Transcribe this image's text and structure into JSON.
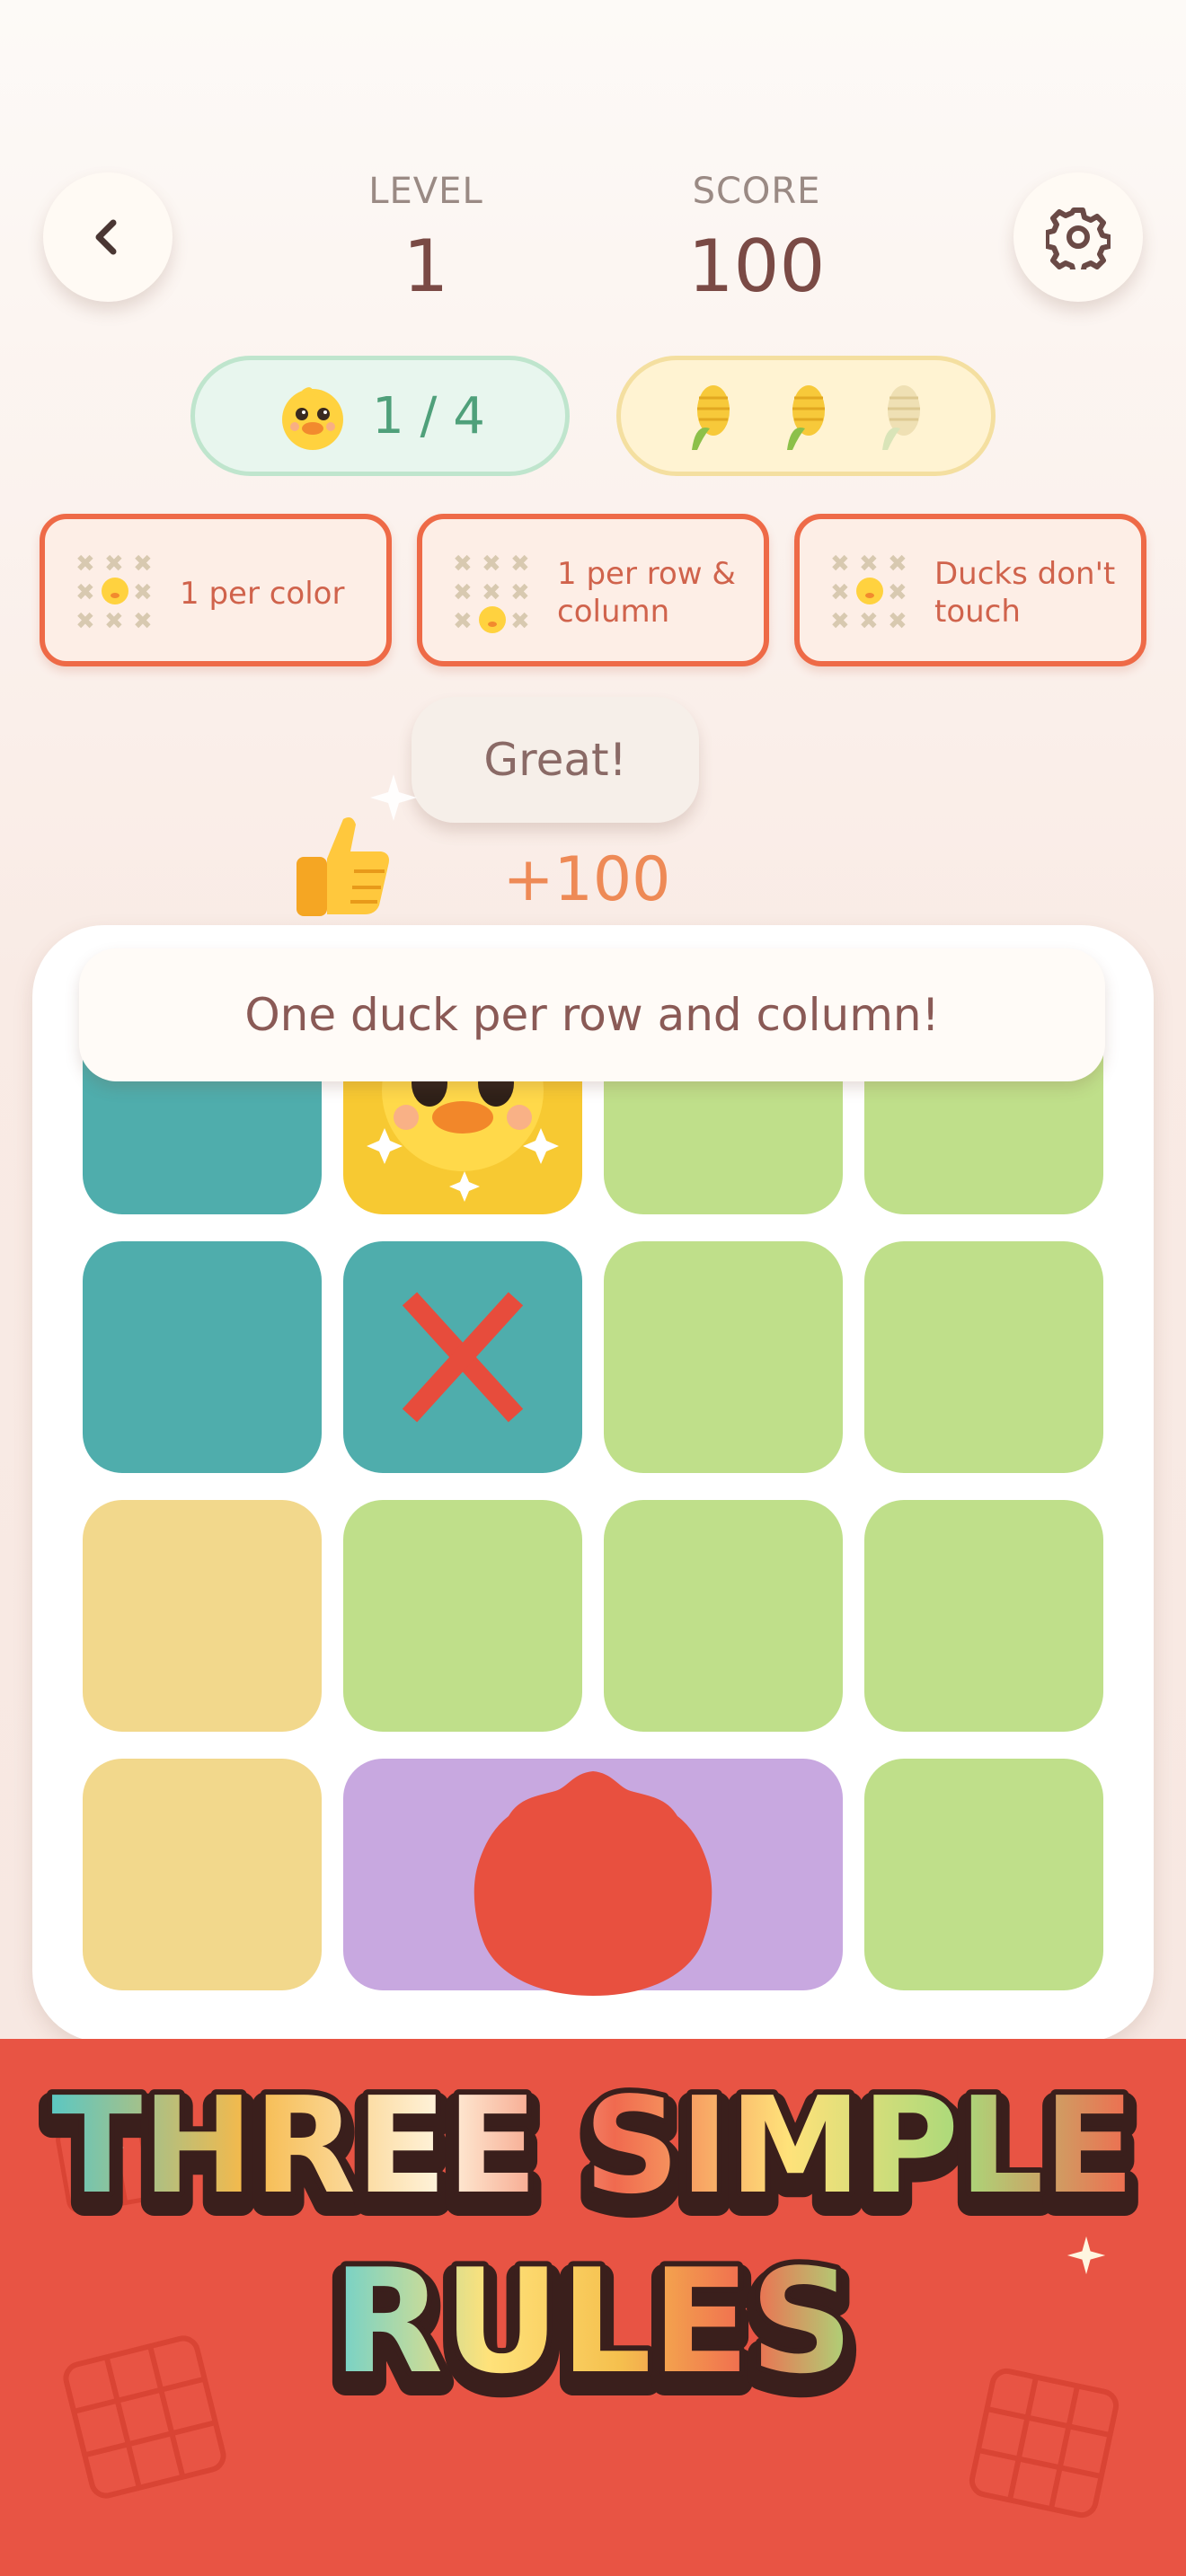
{
  "header": {
    "back_icon": "chevron-left-icon",
    "settings_icon": "gear-icon",
    "level_label": "LEVEL",
    "level_value": "1",
    "score_label": "SCORE",
    "score_value": "100"
  },
  "progress": {
    "ducks_text": "1 / 4",
    "ducks_icon": "duck-icon",
    "corn_icons": [
      "corn-icon",
      "corn-icon",
      "corn-faded-icon"
    ],
    "corn_collected": 2,
    "corn_total": 3
  },
  "rules": [
    {
      "text": "1 per color"
    },
    {
      "text": "1 per row & column"
    },
    {
      "text": "Ducks don't touch"
    }
  ],
  "feedback": {
    "bubble_text": "Great!",
    "score_gain": "+100",
    "thumbs_icon": "thumbs-up-icon"
  },
  "board": {
    "hint": "One duck per row and column!",
    "grid": [
      [
        "teal",
        "yellow-duck",
        "green",
        "green"
      ],
      [
        "teal",
        "teal-x",
        "green",
        "green"
      ],
      [
        "yellow",
        "green",
        "green",
        "green"
      ],
      [
        "yellow",
        "purple",
        "purple",
        "green"
      ]
    ]
  },
  "footer": {
    "title_line1": "THREE SIMPLE",
    "title_line2": "RULES"
  },
  "colors": {
    "accent_red": "#e85444",
    "teal": "#4fadac",
    "green": "#bfdf8a",
    "yellow": "#f2d88c",
    "purple": "#c8a8e0",
    "rule_border": "#ee6a47"
  }
}
